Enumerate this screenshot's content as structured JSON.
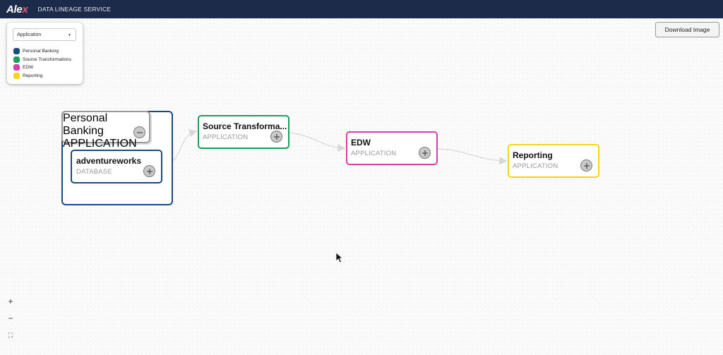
{
  "header": {
    "logo_main": "Ale",
    "logo_accent": "x",
    "title": "DATA LINEAGE SERVICE"
  },
  "legend": {
    "select_value": "Application",
    "items": [
      {
        "label": "Personal Banking",
        "color": "#1b4a7d"
      },
      {
        "label": "Source Transformations",
        "color": "#1aa05a"
      },
      {
        "label": "EDW",
        "color": "#d63fa6"
      },
      {
        "label": "Reporting",
        "color": "#f2d51c"
      }
    ]
  },
  "toolbar": {
    "download_label": "Download Image"
  },
  "nodes": {
    "personal_banking": {
      "name": "Personal Banking",
      "kind": "APPLICATION",
      "color": "#9a9a9a"
    },
    "adventureworks": {
      "name": "adventureworks",
      "kind": "DATABASE",
      "color": "#1b4a7d"
    },
    "source_transformations": {
      "name": "Source Transforma...",
      "kind": "APPLICATION",
      "color": "#1aa05a"
    },
    "edw": {
      "name": "EDW",
      "kind": "APPLICATION",
      "color": "#d63fa6"
    },
    "reporting": {
      "name": "Reporting",
      "kind": "APPLICATION",
      "color": "#f2d51c"
    }
  },
  "zoom": {
    "zoom_in": "+",
    "zoom_out": "−",
    "fit": "⛶"
  }
}
